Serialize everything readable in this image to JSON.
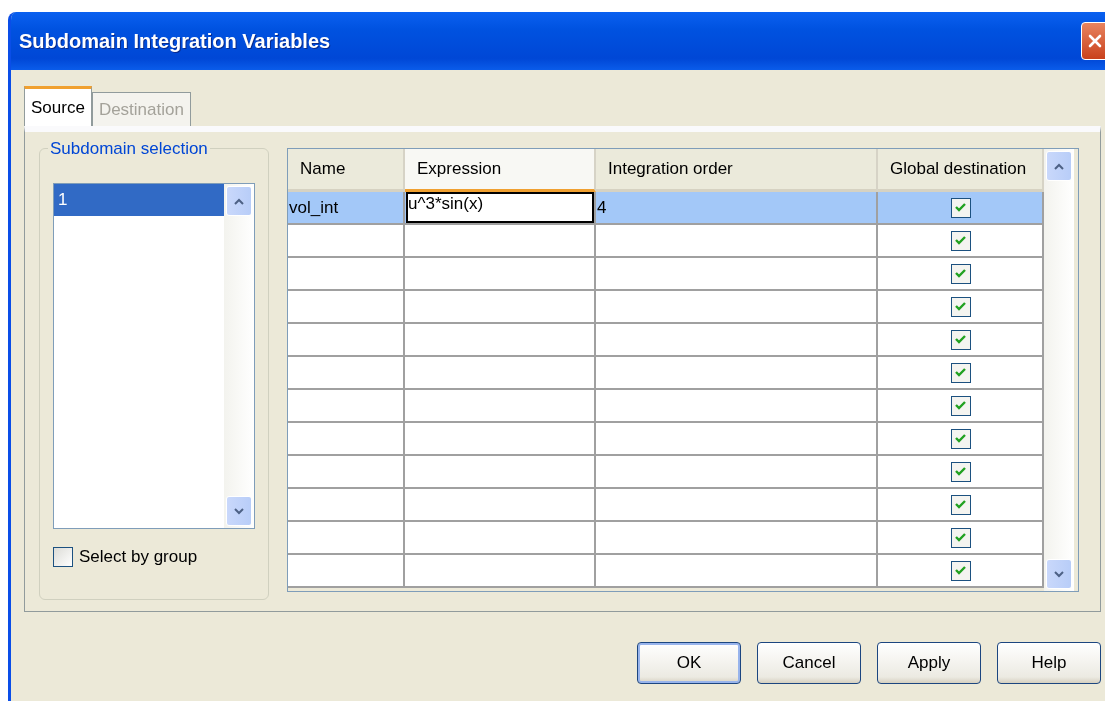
{
  "window": {
    "title": "Subdomain Integration Variables"
  },
  "tabs": [
    {
      "label": "Source",
      "selected": true,
      "disabled": false
    },
    {
      "label": "Destination",
      "selected": false,
      "disabled": true
    }
  ],
  "subdomain_selection": {
    "title": "Subdomain selection",
    "items": [
      {
        "label": "1",
        "selected": true
      }
    ],
    "select_by_group": {
      "label": "Select by group",
      "checked": false
    }
  },
  "table": {
    "columns": [
      {
        "label": "Name",
        "sorted": false
      },
      {
        "label": "Expression",
        "sorted": true
      },
      {
        "label": "Integration order",
        "sorted": false
      },
      {
        "label": "Global destination",
        "sorted": false
      }
    ],
    "rows": [
      {
        "name": "vol_int",
        "expression": "u^3*sin(x)",
        "integration_order": "4",
        "global_destination": true,
        "selected": true
      },
      {
        "global_destination": true,
        "selected": false
      },
      {
        "global_destination": true,
        "selected": false
      },
      {
        "global_destination": true,
        "selected": false
      },
      {
        "global_destination": true,
        "selected": false
      },
      {
        "global_destination": true,
        "selected": false
      },
      {
        "global_destination": true,
        "selected": false
      },
      {
        "global_destination": true,
        "selected": false
      },
      {
        "global_destination": true,
        "selected": false
      },
      {
        "global_destination": true,
        "selected": false
      },
      {
        "global_destination": true,
        "selected": false
      },
      {
        "global_destination": true,
        "selected": false
      }
    ]
  },
  "buttons": [
    {
      "label": "OK",
      "default": true
    },
    {
      "label": "Cancel",
      "default": false
    },
    {
      "label": "Apply",
      "default": false
    },
    {
      "label": "Help",
      "default": false
    }
  ]
}
